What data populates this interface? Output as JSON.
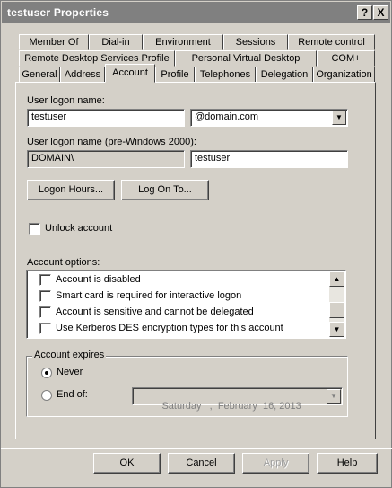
{
  "window": {
    "title": "testuser Properties",
    "help_button": "?",
    "close_button": "X"
  },
  "tabs": {
    "row1": [
      "Member Of",
      "Dial-in",
      "Environment",
      "Sessions",
      "Remote control"
    ],
    "row2": [
      "Remote Desktop Services Profile",
      "Personal Virtual Desktop",
      "COM+"
    ],
    "row3": [
      "General",
      "Address",
      "Account",
      "Profile",
      "Telephones",
      "Delegation",
      "Organization"
    ],
    "active": "Account"
  },
  "account": {
    "logon_name_label": "User logon name:",
    "logon_name_value": "testuser",
    "domain_suffix": "@domain.com",
    "prewin_label": "User logon name (pre-Windows 2000):",
    "prewin_domain": "DOMAIN\\",
    "prewin_user": "testuser",
    "logon_hours_button": "Logon Hours...",
    "logon_to_button": "Log On To...",
    "unlock_label": "Unlock account",
    "unlock_checked": false,
    "options_label": "Account options:",
    "options": [
      {
        "label": "Account is disabled",
        "checked": false
      },
      {
        "label": "Smart card is required for interactive logon",
        "checked": false
      },
      {
        "label": "Account is sensitive and cannot be delegated",
        "checked": false
      },
      {
        "label": "Use Kerberos DES encryption types for this account",
        "checked": false
      }
    ],
    "expires_label": "Account expires",
    "never_label": "Never",
    "endof_label": "End of:",
    "selected_expiry": "Never",
    "end_date": "Saturday   ,  February  16, 2013"
  },
  "footer": {
    "ok": "OK",
    "cancel": "Cancel",
    "apply": "Apply",
    "help": "Help"
  },
  "colors": {
    "face": "#d4d0c8",
    "titlebar": "#808080"
  }
}
